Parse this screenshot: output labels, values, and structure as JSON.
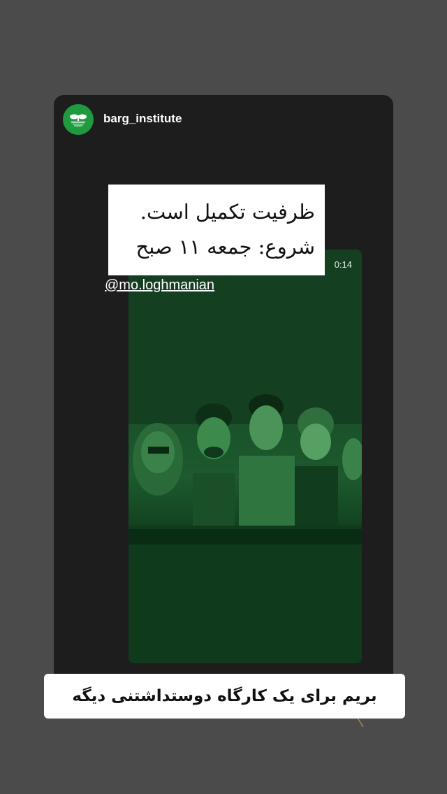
{
  "story": {
    "username": "barg_institute",
    "avatar_icon": "leaf-logo-icon",
    "brand_color": "#1f9a3f"
  },
  "video": {
    "duration": "0:14",
    "tint_color": "#1d5a2d"
  },
  "caption": {
    "line1": "ظرفیت تکمیل است.",
    "line2": "شروع: جمعه ۱۱ صبح"
  },
  "mention": {
    "text": "@mo.loghmanian"
  },
  "bottom_caption": {
    "text": "بریم برای یک کارگاه دوستداشتنی دیگه"
  }
}
